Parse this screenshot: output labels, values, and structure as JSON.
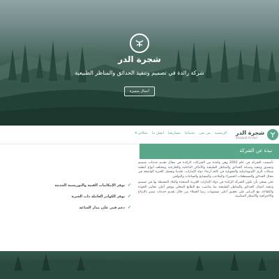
{
  "hero": {
    "brand_title": "شجرة الدر",
    "tagline": "شركة رائدة في تصميم وتنفيذ الحدائق والمناظر الطبيعية",
    "button_label": "أعمال متميزة"
  },
  "navbar": {
    "logo_ar": "شجرة الدر",
    "logo_en": "Shajarat Al-durr",
    "items": [
      {
        "label": "الرئيسية"
      },
      {
        "label": "من نحن"
      },
      {
        "label": "خدماتنا"
      },
      {
        "label": "مشاريعنا"
      },
      {
        "label": "اتصل بنا"
      },
      {
        "label": "عملائي ▾"
      }
    ]
  },
  "about": {
    "title": "نبذة عن الشركة",
    "paragraphs": [
      "تأسست الشركة في عام 2003 وهي واحدة من الشركات الرائدة في مجال تقديم خدمات تصميم وتنسيق وتنفيذ وصيانة الحدائق والمناظر الطبيعية والأماكن الداخلية والخارجية ومختلف أنواع أنظمة شبكات الري الأوتوماتيكية والتحويلية في كافة أرجاء دولة الإمارات. فلدينا وبفضل الخبرة الواسعة في مجال الحدائق والمسطحات الخضراء والملاعب والمسابح والساحات والنوافير.",
      "نحن نسعى بأن نكون الشركة الرائدة في دولة الإمارات العربية المتحدة والبلاد المحيطة بها في تصميم وتنفيذ أعمال الحدائق والمناظر الطبيعية بما يتناسب مع الطابع المحلي ووفق أعلى معايير الجودة والكفاءة، مع التركيز على تحقيق أعلى مستويات رضا العملاء من خلال تقديم خدمات تتميز بالإبداع والاحترافية والأسعار المناسبة."
    ]
  },
  "features": [
    {
      "label": "توفر الإمكانيات الفنية والتوريسية الحديثة"
    },
    {
      "label": "توفر الكوادر العاملة ذات الخبرة"
    },
    {
      "label": "دعم فني على مدار الساعة"
    }
  ],
  "colors": {
    "accent": "#5aa78a",
    "hero_dark": "#1f3a31"
  }
}
